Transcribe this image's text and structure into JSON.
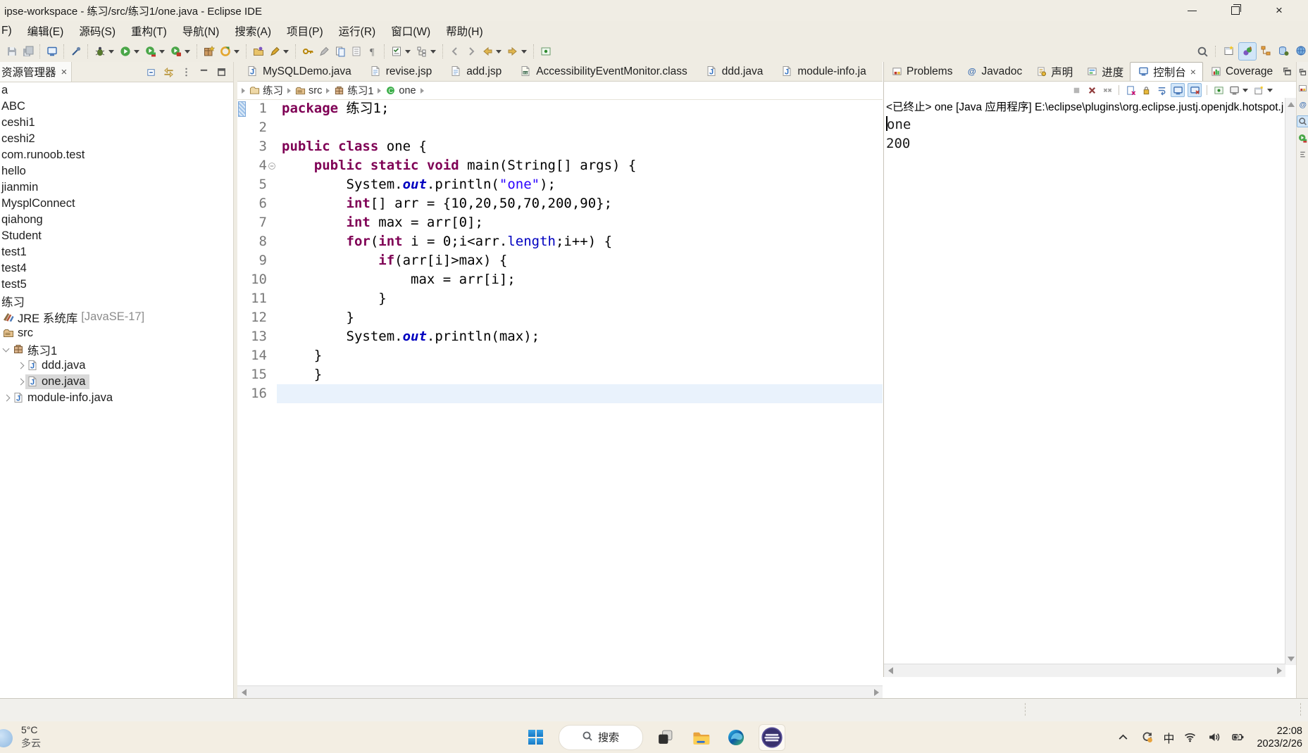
{
  "titlebar": {
    "title": "ipse-workspace - 练习/src/练习1/one.java - Eclipse IDE"
  },
  "menubar": {
    "items": [
      "F)",
      "编辑(E)",
      "源码(S)",
      "重构(T)",
      "导航(N)",
      "搜索(A)",
      "项目(P)",
      "运行(R)",
      "窗口(W)",
      "帮助(H)"
    ]
  },
  "toolbar": {
    "groups": [
      {
        "icons": [
          {
            "n": "save"
          },
          {
            "n": "save-all"
          }
        ]
      },
      {
        "icons": [
          {
            "n": "console-monitor"
          }
        ]
      },
      {
        "icons": [
          {
            "n": "search-wand"
          }
        ]
      },
      {
        "icons": [
          {
            "n": "debug",
            "caret": true
          },
          {
            "n": "run",
            "caret": true
          },
          {
            "n": "coverage",
            "caret": true
          },
          {
            "n": "profile",
            "caret": true
          }
        ]
      },
      {
        "icons": [
          {
            "n": "new-java-project"
          },
          {
            "n": "new-wizard",
            "caret": true
          }
        ]
      },
      {
        "icons": [
          {
            "n": "open-resource"
          },
          {
            "n": "annotate",
            "caret": true
          }
        ]
      },
      {
        "icons": [
          {
            "n": "key"
          },
          {
            "n": "pen-grey"
          },
          {
            "n": "copy-doc"
          },
          {
            "n": "list-doc"
          },
          {
            "n": "pilcrow"
          }
        ]
      },
      {
        "icons": [
          {
            "n": "checklist",
            "caret": true
          },
          {
            "n": "tree-view",
            "caret": true
          }
        ]
      },
      {
        "icons": [
          {
            "n": "nav-back-thin"
          },
          {
            "n": "nav-fwd-thin"
          },
          {
            "n": "back-gold",
            "caret": true
          },
          {
            "n": "fwd-gold",
            "caret": true
          }
        ]
      },
      {
        "icons": [
          {
            "n": "pin-editor"
          }
        ]
      }
    ],
    "perspectives": [
      {
        "n": "open-perspective"
      },
      {
        "n": "java-perspective",
        "active": true
      },
      {
        "n": "hierarchy-perspective"
      },
      {
        "n": "debug-perspective"
      },
      {
        "n": "globe-perspective"
      }
    ]
  },
  "explorer": {
    "tab_label": "资源管理器",
    "toolbar": [
      "collapse-all",
      "link-with-editor",
      "view-menu",
      "minimize",
      "maximize"
    ],
    "items": [
      {
        "label": "a",
        "kind": "project"
      },
      {
        "label": "ABC",
        "kind": "project"
      },
      {
        "label": "ceshi1",
        "kind": "project"
      },
      {
        "label": "ceshi2",
        "kind": "project"
      },
      {
        "label": "com.runoob.test",
        "kind": "project"
      },
      {
        "label": "hello",
        "kind": "project"
      },
      {
        "label": "jianmin",
        "kind": "project"
      },
      {
        "label": "MysplConnect",
        "kind": "project"
      },
      {
        "label": "qiahong",
        "kind": "project"
      },
      {
        "label": "Student",
        "kind": "project"
      },
      {
        "label": "test1",
        "kind": "project"
      },
      {
        "label": "test4",
        "kind": "project"
      },
      {
        "label": "test5",
        "kind": "project"
      },
      {
        "label": "练习",
        "kind": "project"
      },
      {
        "label": "JRE 系统库",
        "suffix": "[JavaSE-17]",
        "kind": "lib"
      },
      {
        "label": "src",
        "kind": "srcfolder"
      },
      {
        "label": "练习1",
        "kind": "pkg",
        "expanded": true
      },
      {
        "label": "ddd.java",
        "kind": "file2"
      },
      {
        "label": "one.java",
        "kind": "file2",
        "selected": true
      },
      {
        "label": "module-info.java",
        "kind": "file1"
      }
    ]
  },
  "editor": {
    "tabs": [
      {
        "label": "MySQLDemo.java",
        "icon": "javafile"
      },
      {
        "label": "revise.jsp",
        "icon": "jspfile"
      },
      {
        "label": "add.jsp",
        "icon": "jspfile"
      },
      {
        "label": "AccessibilityEventMonitor.class",
        "icon": "classfile"
      },
      {
        "label": "ddd.java",
        "icon": "javafile"
      },
      {
        "label": "module-info.ja",
        "icon": "javafile"
      }
    ],
    "breadcrumb": [
      {
        "label": "练习",
        "icon": "bc-folder"
      },
      {
        "label": "src",
        "icon": "srcfolder"
      },
      {
        "label": "练习1",
        "icon": "pkg"
      },
      {
        "label": "one",
        "icon": "bc-class"
      }
    ],
    "code": [
      {
        "n": 1,
        "mark": true,
        "tokens": [
          [
            "kw",
            "package"
          ],
          [
            "pl",
            " 练习1;"
          ]
        ]
      },
      {
        "n": 2,
        "tokens": []
      },
      {
        "n": 3,
        "tokens": [
          [
            "kw",
            "public"
          ],
          [
            "pl",
            " "
          ],
          [
            "kw",
            "class"
          ],
          [
            "pl",
            " one {"
          ]
        ]
      },
      {
        "n": 4,
        "fold": true,
        "tokens": [
          [
            "pl",
            "    "
          ],
          [
            "kw",
            "public"
          ],
          [
            "pl",
            " "
          ],
          [
            "kw",
            "static"
          ],
          [
            "pl",
            " "
          ],
          [
            "kw",
            "void"
          ],
          [
            "pl",
            " main(String[] args) {"
          ]
        ]
      },
      {
        "n": 5,
        "tokens": [
          [
            "pl",
            "        System."
          ],
          [
            "fld",
            "out"
          ],
          [
            "pl",
            ".println("
          ],
          [
            "str",
            "\"one\""
          ],
          [
            "pl",
            ");"
          ]
        ]
      },
      {
        "n": 6,
        "tokens": [
          [
            "pl",
            "        "
          ],
          [
            "kw",
            "int"
          ],
          [
            "pl",
            "[] arr = {10,20,50,70,200,90};"
          ]
        ]
      },
      {
        "n": 7,
        "tokens": [
          [
            "pl",
            "        "
          ],
          [
            "kw",
            "int"
          ],
          [
            "pl",
            " max = arr[0];"
          ]
        ]
      },
      {
        "n": 8,
        "tokens": [
          [
            "pl",
            "        "
          ],
          [
            "kw",
            "for"
          ],
          [
            "pl",
            "("
          ],
          [
            "kw",
            "int"
          ],
          [
            "pl",
            " i = 0;i<arr."
          ],
          [
            "fl2",
            "length"
          ],
          [
            "pl",
            ";i++) {"
          ]
        ]
      },
      {
        "n": 9,
        "tokens": [
          [
            "pl",
            "            "
          ],
          [
            "kw",
            "if"
          ],
          [
            "pl",
            "(arr[i]>max) {"
          ]
        ]
      },
      {
        "n": 10,
        "tokens": [
          [
            "pl",
            "                max = arr[i];"
          ]
        ]
      },
      {
        "n": 11,
        "tokens": [
          [
            "pl",
            "            }"
          ]
        ]
      },
      {
        "n": 12,
        "tokens": [
          [
            "pl",
            "        }"
          ]
        ]
      },
      {
        "n": 13,
        "tokens": [
          [
            "pl",
            "        System."
          ],
          [
            "fld",
            "out"
          ],
          [
            "pl",
            ".println(max);"
          ]
        ]
      },
      {
        "n": 14,
        "tokens": [
          [
            "pl",
            "    }"
          ]
        ]
      },
      {
        "n": 15,
        "tokens": [
          [
            "pl",
            "    }"
          ]
        ]
      },
      {
        "n": 16,
        "current": true,
        "tokens": []
      }
    ]
  },
  "console": {
    "tabs": [
      {
        "label": "Problems",
        "icon": "problems"
      },
      {
        "label": "Javadoc",
        "icon": "javadoc"
      },
      {
        "label": "声明",
        "icon": "declaration"
      },
      {
        "label": "进度",
        "icon": "progress"
      },
      {
        "label": "控制台",
        "icon": "consoleic",
        "active": true,
        "closable": true
      },
      {
        "label": "Coverage",
        "icon": "coverageic"
      }
    ],
    "toolbar": [
      {
        "n": "terminate"
      },
      {
        "n": "remove-launch"
      },
      {
        "n": "remove-all"
      },
      {
        "sep": true
      },
      {
        "n": "clear-console"
      },
      {
        "n": "scroll-lock"
      },
      {
        "n": "word-wrap"
      },
      {
        "n": "show-stdout",
        "on": true
      },
      {
        "n": "show-stderr",
        "on": true
      },
      {
        "sep": true
      },
      {
        "n": "pin-console"
      },
      {
        "n": "display-console",
        "caret": true
      },
      {
        "n": "open-console",
        "caret": true
      }
    ],
    "header": "<已终止> one [Java 应用程序] E:\\eclipse\\plugins\\org.eclipse.justj.openjdk.hotspot.j",
    "output": [
      "one",
      "200"
    ]
  },
  "strip": {
    "icons": [
      {
        "n": "restore-panel"
      },
      {
        "n": "problems-mini"
      },
      {
        "n": "javadoc-mini"
      },
      {
        "n": "search-mini",
        "on": true
      },
      {
        "n": "coverage-mini"
      },
      {
        "n": "outline-mini"
      }
    ]
  },
  "taskbar": {
    "weather": {
      "temp": "5°C",
      "condition": "多云"
    },
    "search_label": "搜索",
    "apps": [
      {
        "n": "start"
      },
      {
        "n": "search-pill"
      },
      {
        "n": "task-view"
      },
      {
        "n": "file-explorer"
      },
      {
        "n": "edge"
      },
      {
        "n": "eclipse",
        "active": true
      }
    ],
    "tray": {
      "ime": "中",
      "time": "22:08",
      "date": "2023/2/26"
    }
  },
  "colors": {
    "keyword": "#7f0055",
    "string": "#2a00ff",
    "field": "#0000c0",
    "current_line": "#e9f2fc",
    "selection": "#d9d9d9",
    "chrome": "#f0ede4",
    "accent_highlight": "#d2e6f8"
  }
}
